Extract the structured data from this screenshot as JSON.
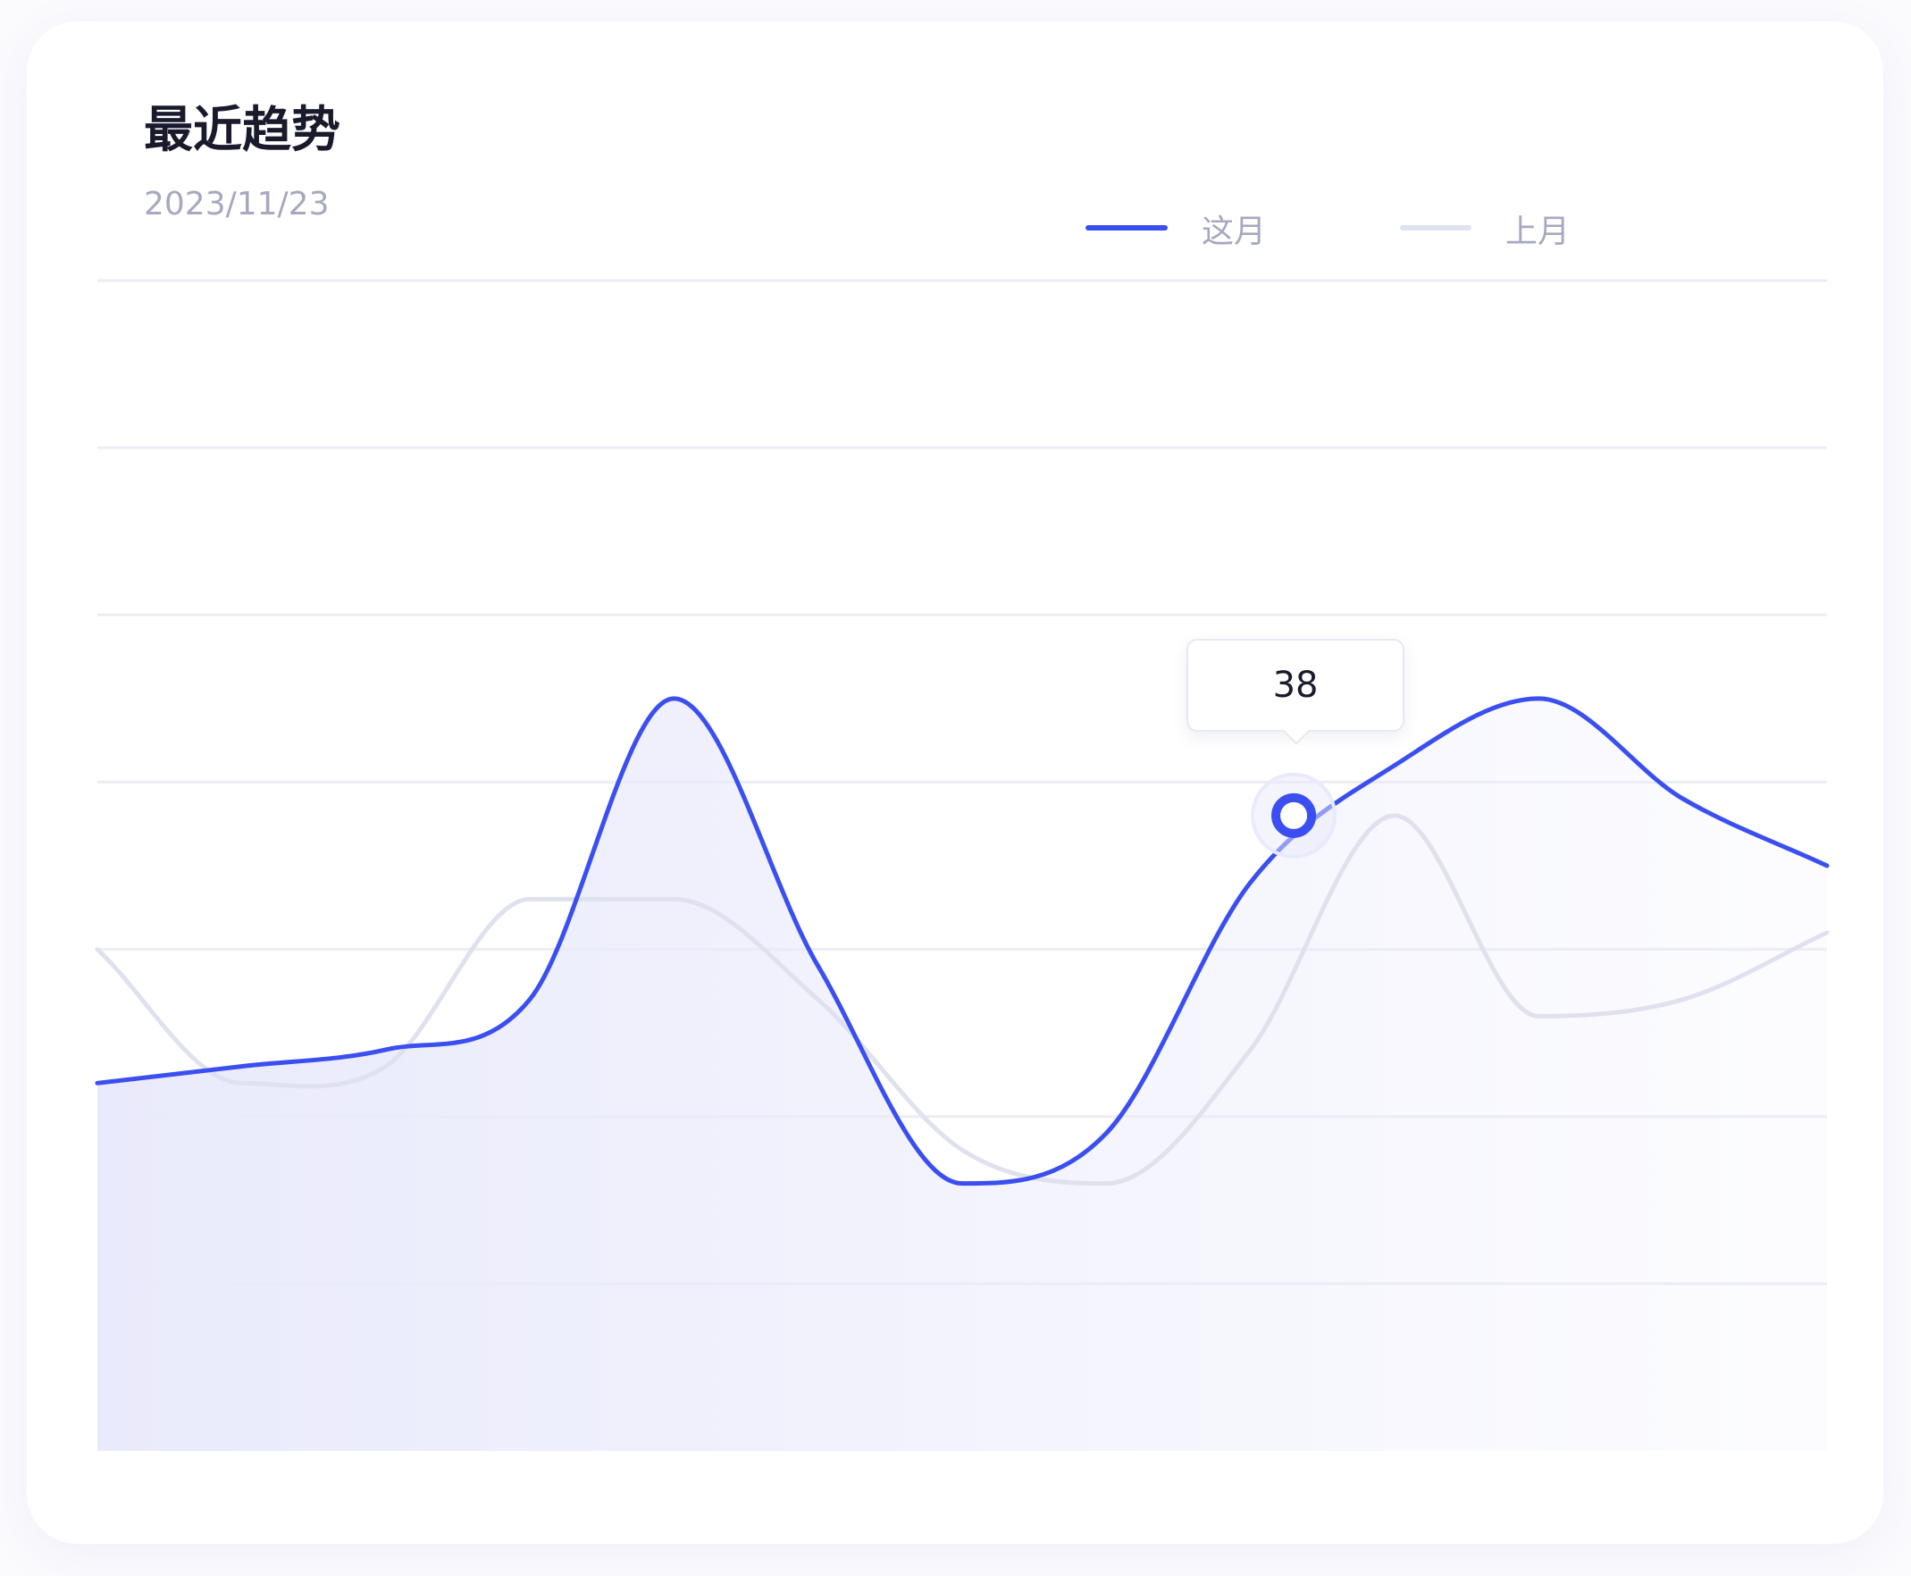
{
  "card": {
    "title": "最近趋势",
    "date": "2023/11/23"
  },
  "legend": {
    "this_month": "这月",
    "last_month": "上月"
  },
  "tooltip": {
    "value": "38"
  },
  "colors": {
    "this_month": "#3b4ff1",
    "last_month": "#e0e1ee",
    "grid": "#ecedf4",
    "area_fill": "#e9eafb"
  },
  "chart_data": {
    "type": "line",
    "x": [
      0,
      1,
      2,
      3,
      4,
      5,
      6,
      7,
      8,
      9,
      10,
      11,
      12
    ],
    "ylim": [
      0,
      70
    ],
    "grid": true,
    "legend_position": "top-right",
    "series": [
      {
        "name": "这月",
        "values": [
          22,
          23,
          24,
          27,
          45,
          29,
          16,
          19,
          34,
          41,
          45,
          39,
          35
        ],
        "area": true
      },
      {
        "name": "上月",
        "values": [
          30,
          22,
          23,
          33,
          33,
          27,
          18,
          16,
          24,
          38,
          26,
          27,
          31
        ]
      }
    ],
    "highlight": {
      "series": "这月",
      "x": 8.3,
      "y": 38
    }
  }
}
